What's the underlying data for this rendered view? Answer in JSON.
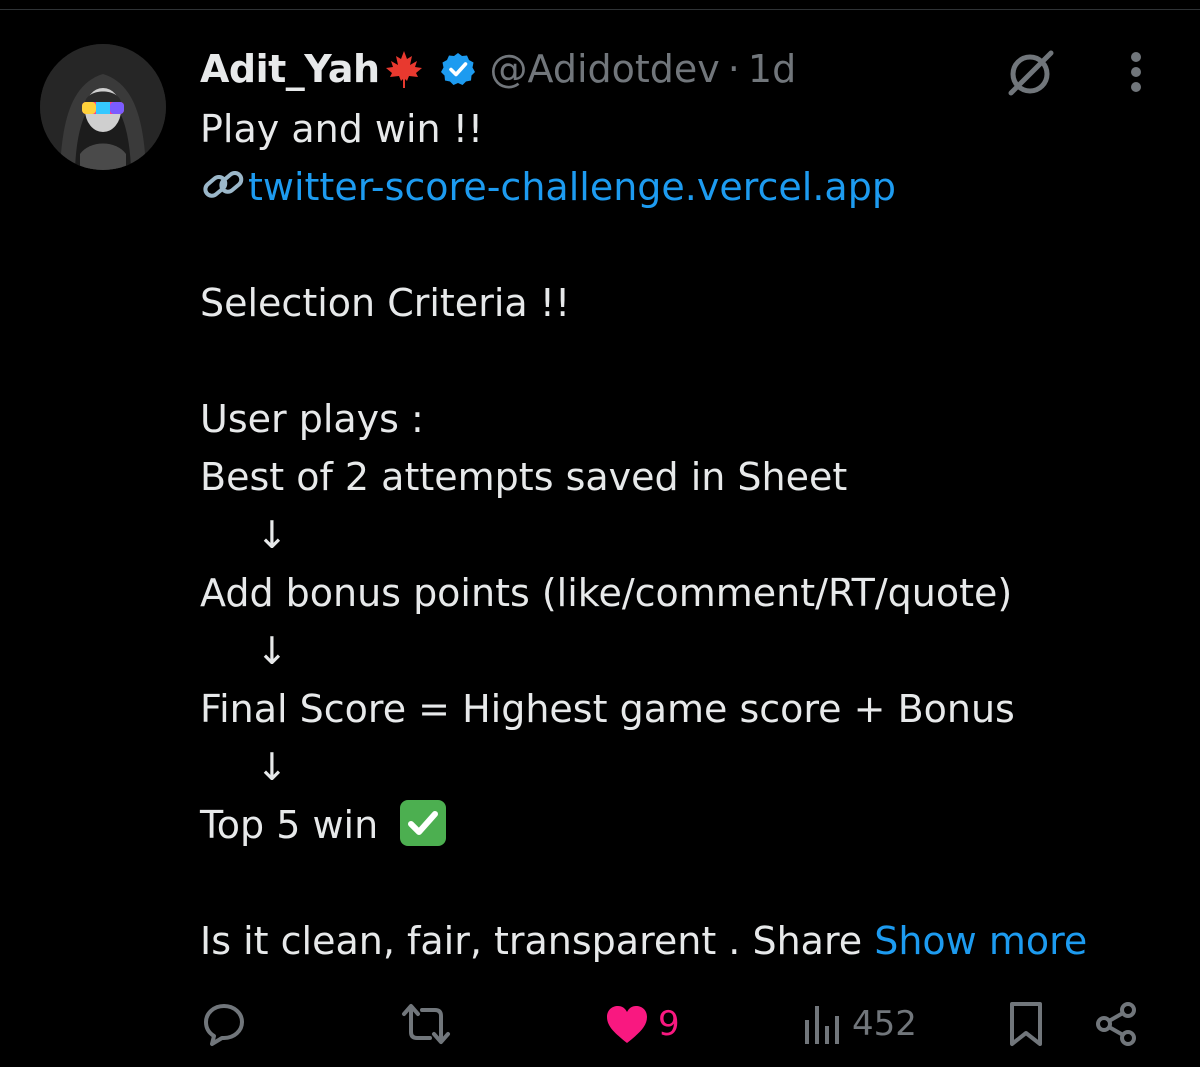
{
  "tweet": {
    "author": {
      "display_name": "Adit_Yah",
      "handle": "@Adidotdev",
      "separator": "·",
      "timestamp": "1d"
    },
    "lines": {
      "l1": "Play and win !!",
      "link": "twitter-score-challenge.vercel.app",
      "l3": "Selection Criteria !!",
      "l4": "User plays :",
      "l5": "Best of 2 attempts saved in Sheet",
      "arrow": "↓",
      "l6": "Add bonus points  (like/comment/RT/quote)",
      "l7": "Final Score = Highest game score + Bonus",
      "l8": "Top 5 win",
      "l9": "Is it clean, fair, transparent . Share"
    },
    "show_more_label": "Show more"
  },
  "actions": {
    "likes": "9",
    "views": "452"
  },
  "colors": {
    "background": "#000000",
    "text": "#e7e9ea",
    "muted": "#71767b",
    "accent": "#1d9bf0",
    "like": "#f91880",
    "verified": "#1d9bf0"
  },
  "icons": [
    "maple-leaf-icon",
    "verified-badge-icon",
    "grok-icon",
    "more-icon",
    "link-icon",
    "check-icon",
    "reply-icon",
    "retweet-icon",
    "like-icon",
    "views-icon",
    "bookmark-icon",
    "share-icon"
  ]
}
